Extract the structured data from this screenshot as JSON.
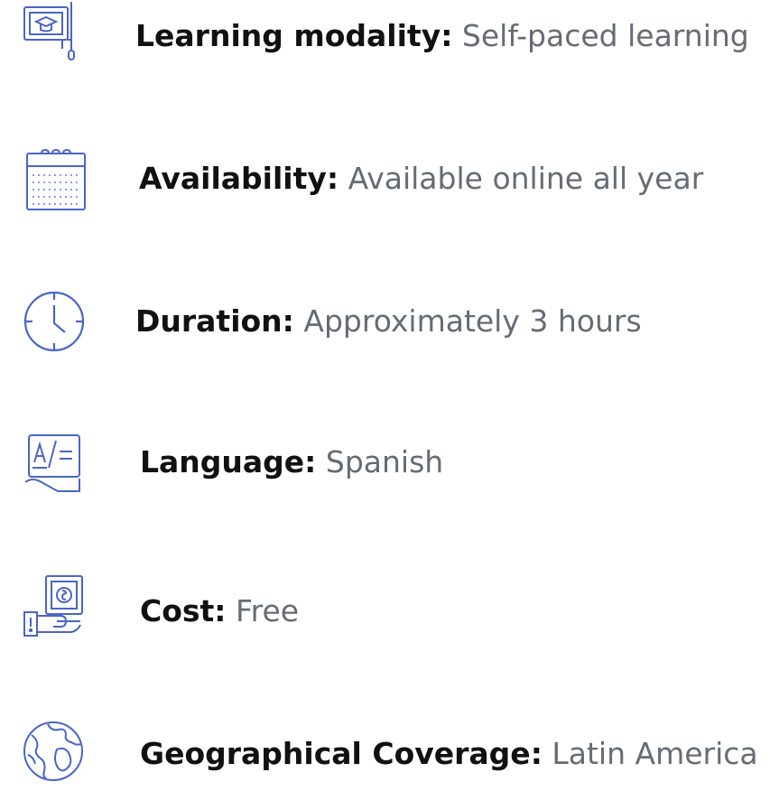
{
  "colors": {
    "icon": "#4a65c8",
    "label": "#111111",
    "value": "#666b75",
    "background": "#ffffff"
  },
  "items": [
    {
      "icon": "online-course-icon",
      "label": "Learning modality:",
      "value": "Self-paced learning"
    },
    {
      "icon": "calendar-icon",
      "label": "Availability:",
      "value": "Available online all year"
    },
    {
      "icon": "clock-icon",
      "label": "Duration:",
      "value": "Approximately 3 hours"
    },
    {
      "icon": "translation-icon",
      "label": "Language:",
      "value": "Spanish"
    },
    {
      "icon": "money-icon",
      "label": "Cost:",
      "value": "Free"
    },
    {
      "icon": "globe-icon",
      "label": "Geographical Coverage:",
      "value": "Latin America"
    }
  ]
}
